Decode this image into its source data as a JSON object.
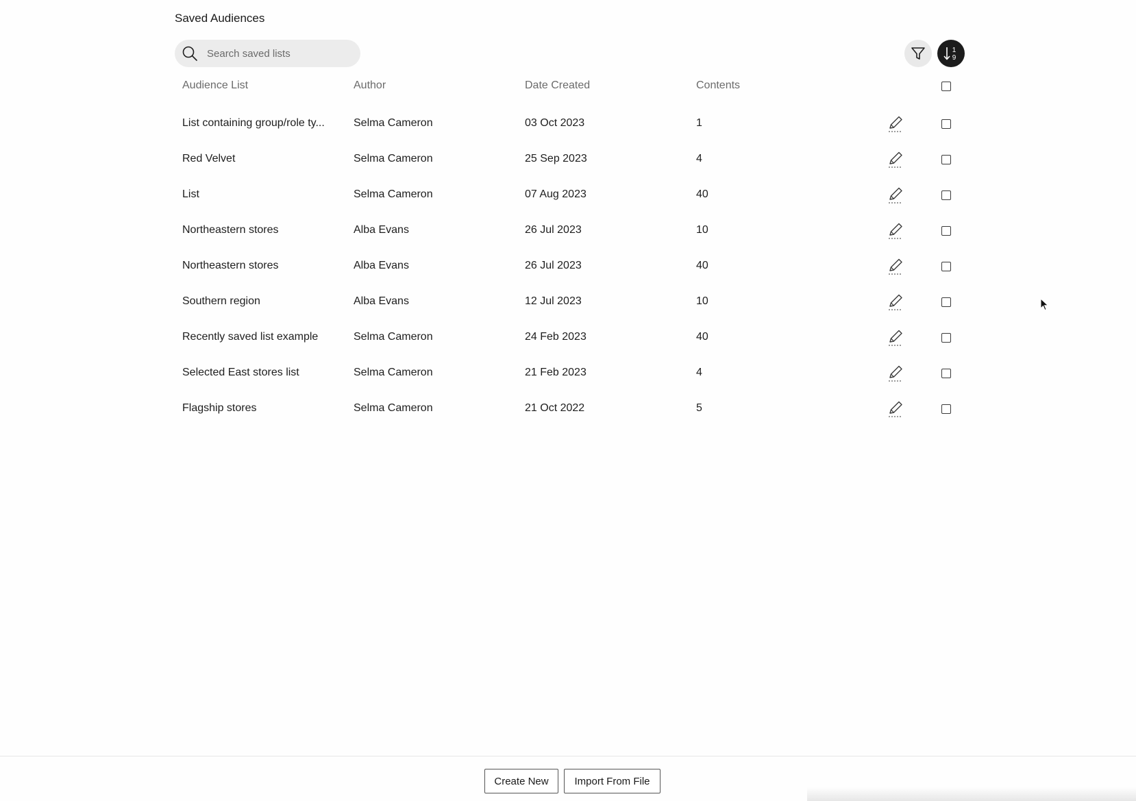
{
  "page": {
    "title": "Saved Audiences"
  },
  "search": {
    "placeholder": "Search saved lists",
    "value": ""
  },
  "toolbar": {
    "filter_icon": "funnel-icon",
    "sort_icon": "sort-numeric-ascending-icon",
    "sort_glyph_top": "1",
    "sort_glyph_bottom": "9"
  },
  "table": {
    "columns": [
      "Audience List",
      "Author",
      "Date Created",
      "Contents"
    ],
    "rows": [
      {
        "name": "List containing group/role ty...",
        "author": "Selma Cameron",
        "date": "03 Oct 2023",
        "contents": "1"
      },
      {
        "name": "Red Velvet",
        "author": "Selma Cameron",
        "date": "25 Sep 2023",
        "contents": "4"
      },
      {
        "name": "List",
        "author": "Selma Cameron",
        "date": "07 Aug 2023",
        "contents": "40"
      },
      {
        "name": "Northeastern stores",
        "author": "Alba Evans",
        "date": "26 Jul 2023",
        "contents": "10"
      },
      {
        "name": "Northeastern stores",
        "author": "Alba Evans",
        "date": "26 Jul 2023",
        "contents": "40"
      },
      {
        "name": "Southern region",
        "author": "Alba Evans",
        "date": "12 Jul 2023",
        "contents": "10"
      },
      {
        "name": "Recently saved list example",
        "author": "Selma Cameron",
        "date": "24 Feb 2023",
        "contents": "40"
      },
      {
        "name": "Selected East stores list",
        "author": "Selma Cameron",
        "date": "21 Feb 2023",
        "contents": "4"
      },
      {
        "name": "Flagship stores",
        "author": "Selma Cameron",
        "date": "21 Oct 2022",
        "contents": "5"
      }
    ]
  },
  "footer": {
    "create_label": "Create New",
    "import_label": "Import From File"
  },
  "colors": {
    "sort_button_bg": "#1c1c1c",
    "filter_button_bg": "#e9e9e9",
    "search_bg": "#ececec",
    "header_text": "#6b6b6b"
  }
}
